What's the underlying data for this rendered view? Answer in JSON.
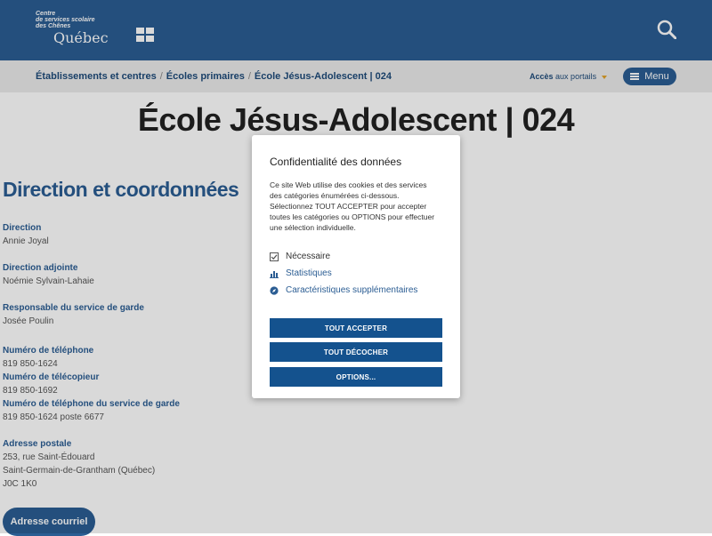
{
  "header": {
    "logo_line1": "Centre",
    "logo_line2": "de services scolaire",
    "logo_line3": "des Chênes",
    "logo_quebec": "Québec"
  },
  "breadcrumb": {
    "items": [
      "Établissements et centres",
      "Écoles primaires",
      "École Jésus-Adolescent | 024"
    ],
    "separator": "/"
  },
  "portals": {
    "bold": "Accès",
    "rest": "aux portails"
  },
  "menu": {
    "label": "Menu"
  },
  "page_title": "École Jésus-Adolescent | 024",
  "section_title": "Direction et coordonnées",
  "contacts": [
    {
      "label": "Direction",
      "value": "Annie Joyal"
    },
    {
      "label": "Direction adjointe",
      "value": "Noémie Sylvain-Lahaie"
    },
    {
      "label": "Responsable du service de garde",
      "value": "Josée Poulin"
    },
    {
      "label": "Numéro de téléphone",
      "value": "819 850-1624"
    },
    {
      "label": "Numéro de télécopieur",
      "value": "819 850-1692"
    },
    {
      "label": "Numéro de téléphone du service de garde",
      "value": "819 850-1624 poste 6677"
    }
  ],
  "address": {
    "label": "Adresse postale",
    "lines": [
      "253, rue Saint-Édouard",
      "Saint-Germain-de-Grantham (Québec)",
      "J0C 1K0"
    ]
  },
  "email_button": "Adresse courriel",
  "privacy_modal": {
    "title": "Confidentialité des données",
    "description": "Ce site Web utilise des cookies et des services des catégories énumérées ci-dessous. Sélectionnez TOUT ACCEPTER pour accepter toutes les catégories ou OPTIONS pour effectuer une sélection individuelle.",
    "categories": [
      "Nécessaire",
      "Statistiques",
      "Caractéristiques supplémentaires"
    ],
    "accept_all": "TOUT ACCEPTER",
    "uncheck_all": "TOUT DÉCOCHER",
    "options": "OPTIONS..."
  }
}
